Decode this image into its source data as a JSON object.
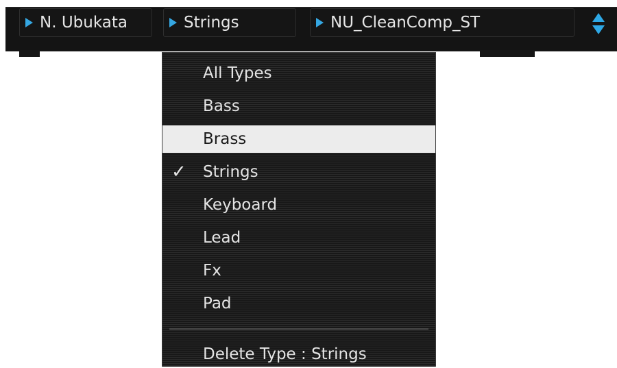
{
  "toolbar": {
    "author": {
      "label": "N. Ubukata"
    },
    "type": {
      "label": "Strings"
    },
    "preset": {
      "label": "NU_CleanComp_ST"
    },
    "spinner": {
      "icon_up": "arrow-up-icon",
      "icon_down": "arrow-down-icon"
    }
  },
  "menu": {
    "items": [
      {
        "label": "All Types"
      },
      {
        "label": "Bass"
      },
      {
        "label": "Brass"
      },
      {
        "label": "Strings"
      },
      {
        "label": "Keyboard"
      },
      {
        "label": "Lead"
      },
      {
        "label": "Fx"
      },
      {
        "label": "Pad"
      }
    ],
    "checked_item": "Strings",
    "highlighted_item": "Brass",
    "check_mark": "✓",
    "delete_label": "Delete Type : Strings"
  },
  "colors": {
    "accent": "#35a7e2",
    "background": "#141414",
    "highlight": "#ececec"
  }
}
